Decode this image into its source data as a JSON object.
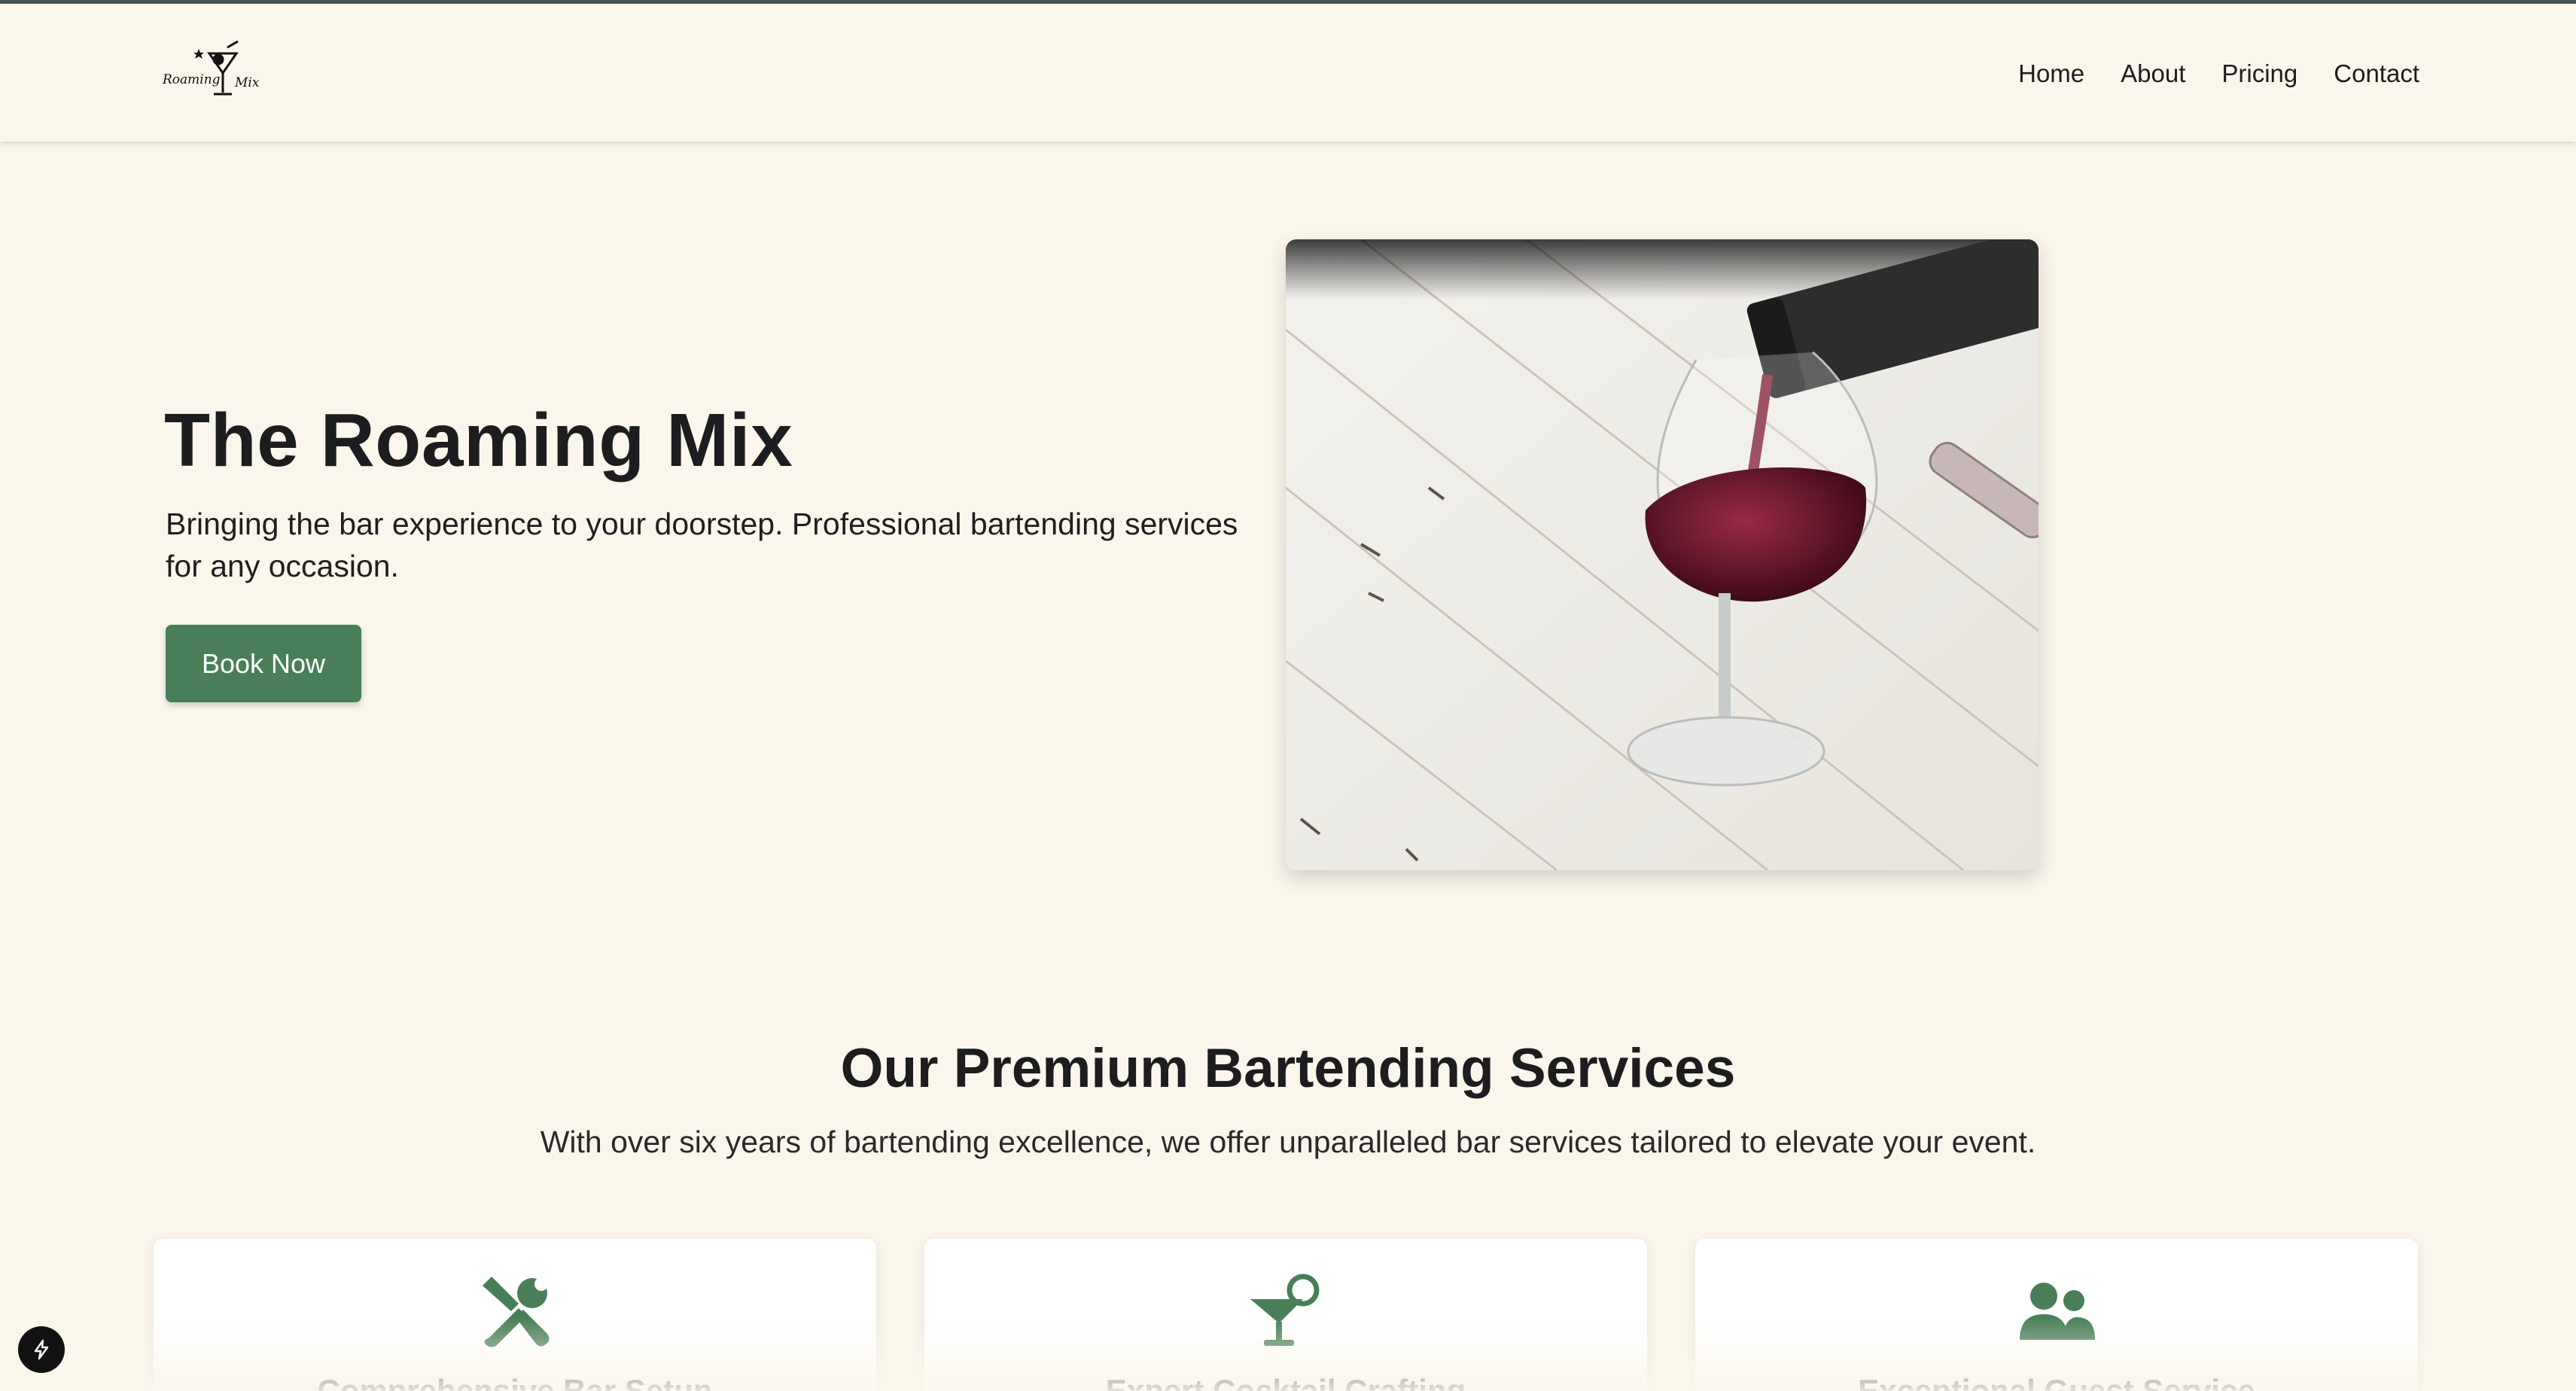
{
  "brand": {
    "logo_text_1": "Roaming",
    "logo_text_2": "Mix"
  },
  "nav": {
    "items": [
      {
        "label": "Home"
      },
      {
        "label": "About"
      },
      {
        "label": "Pricing"
      },
      {
        "label": "Contact"
      }
    ]
  },
  "hero": {
    "title": "The Roaming Mix",
    "subtitle": "Bringing the bar experience to your doorstep. Professional bartending services for any occasion.",
    "cta_label": "Book Now",
    "image_icon": "wine-pour-photo"
  },
  "services": {
    "title": "Our Premium Bartending Services",
    "subtitle": "With over six years of bartending excellence, we offer unparalleled bar services tailored to elevate your event.",
    "cards": [
      {
        "title": "Comprehensive Bar Setup",
        "icon": "tools-icon"
      },
      {
        "title": "Expert Cocktail Crafting",
        "icon": "cocktail-icon"
      },
      {
        "title": "Exceptional Guest Service",
        "icon": "users-icon"
      }
    ]
  },
  "colors": {
    "background": "#faf6ec",
    "accent": "#487f58",
    "text": "#1d1d1f"
  },
  "floating": {
    "icon": "bolt-icon"
  }
}
